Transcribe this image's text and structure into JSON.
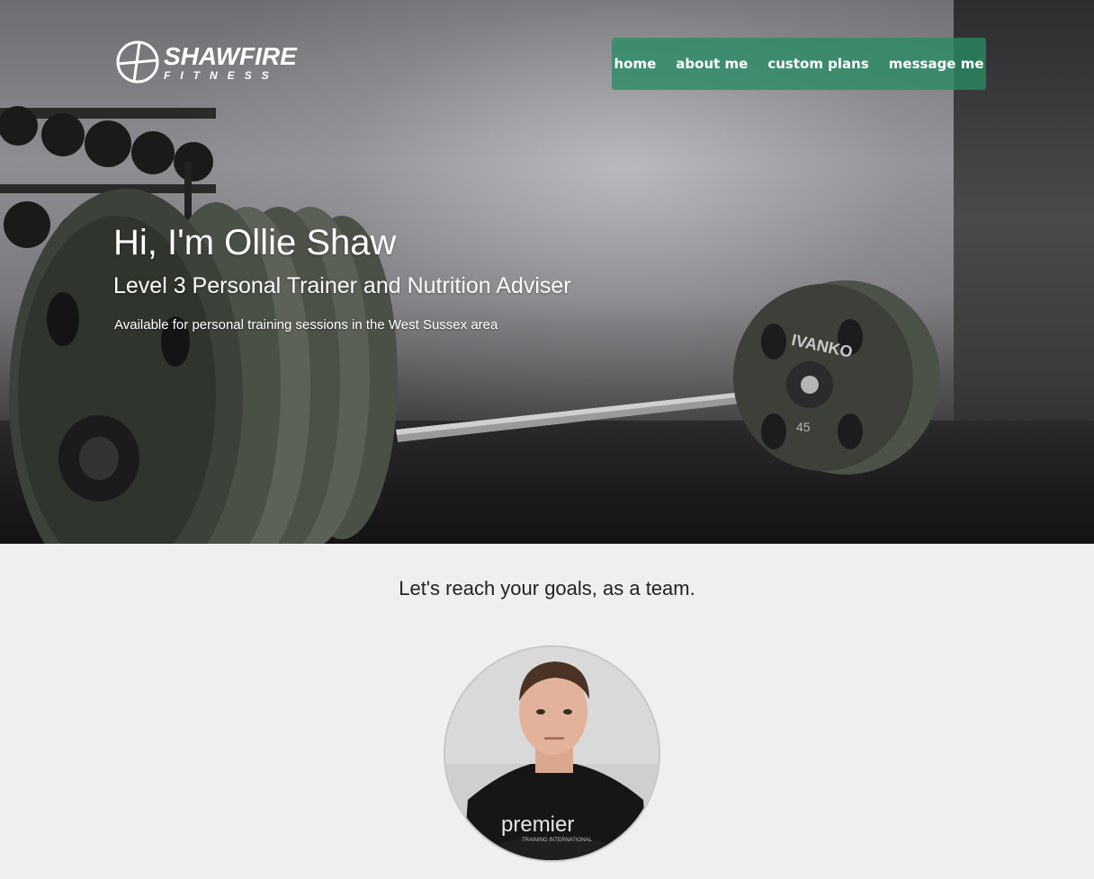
{
  "brand": {
    "name": "SHAWFIRE",
    "tagline": "FITNESS",
    "logo_icon": "crosshair-circle-icon"
  },
  "nav": {
    "items": [
      {
        "label": "home"
      },
      {
        "label": "about me"
      },
      {
        "label": "custom plans"
      },
      {
        "label": "message me"
      }
    ],
    "background_color": "#288c64"
  },
  "hero": {
    "title": "Hi, I'm Ollie Shaw",
    "subtitle": "Level 3 Personal Trainer and Nutrition Adviser",
    "description": "Available for personal training sessions in the West Sussex area",
    "plate_brand": "IVANKO",
    "plate_weight": "45"
  },
  "main": {
    "tagline": "Let's reach your goals, as a team.",
    "avatar": {
      "shirt_text": "premier",
      "shirt_subtext": "TRAINING INTERNATIONAL"
    }
  }
}
